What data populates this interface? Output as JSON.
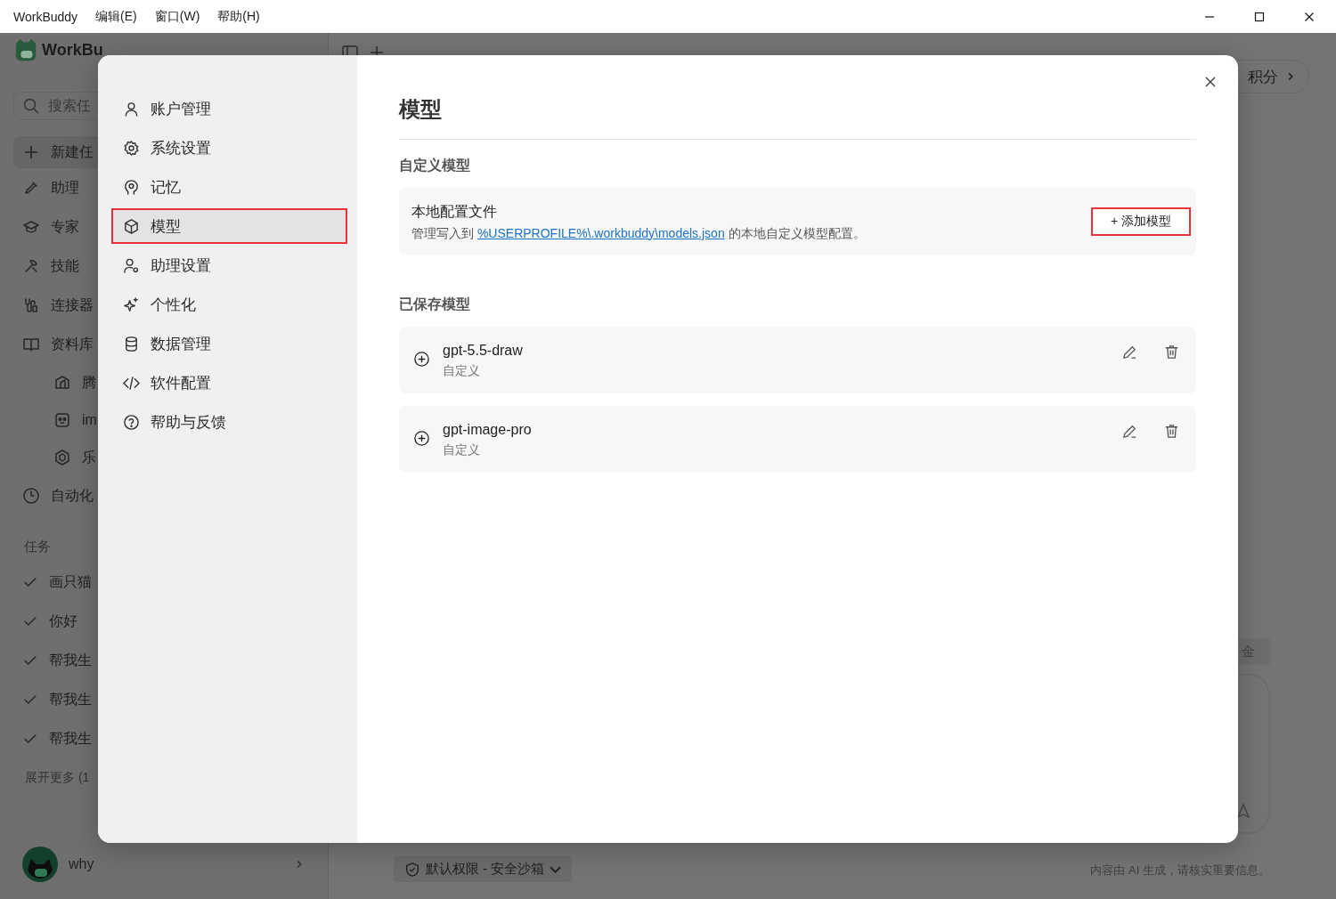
{
  "title_bar": {
    "app_name": "WorkBuddy",
    "menus": [
      "编辑(E)",
      "窗口(W)",
      "帮助(H)"
    ]
  },
  "sidebar": {
    "logo_text": "WorkBu",
    "search_placeholder": "搜索任",
    "new_task": "新建任",
    "items": [
      {
        "label": "助理",
        "kind": "item"
      },
      {
        "label": "专家",
        "kind": "item"
      },
      {
        "label": "技能",
        "kind": "item"
      },
      {
        "label": "连接器",
        "kind": "item"
      },
      {
        "label": "资料库",
        "kind": "item"
      },
      {
        "label": "腾",
        "kind": "subitem"
      },
      {
        "label": "im",
        "kind": "subitem"
      },
      {
        "label": "乐",
        "kind": "subitem"
      },
      {
        "label": "自动化",
        "kind": "item"
      }
    ],
    "tasks_heading": "任务",
    "tasks": [
      "画只猫",
      "你好",
      "帮我生",
      "帮我生",
      "帮我生"
    ],
    "more": "展开更多 (1",
    "user": "why"
  },
  "main": {
    "points_chip": "积分",
    "tag_chip": "金",
    "permission": "默认权限 - 安全沙箱",
    "disclaimer": "内容由 AI 生成，请核实重要信息。"
  },
  "settings": {
    "nav": [
      {
        "label": "账户管理",
        "selected": false,
        "highlighted": false
      },
      {
        "label": "系统设置",
        "selected": false,
        "highlighted": false
      },
      {
        "label": "记忆",
        "selected": false,
        "highlighted": false
      },
      {
        "label": "模型",
        "selected": true,
        "highlighted": true
      },
      {
        "label": "助理设置",
        "selected": false,
        "highlighted": false
      },
      {
        "label": "个性化",
        "selected": false,
        "highlighted": false
      },
      {
        "label": "数据管理",
        "selected": false,
        "highlighted": false
      },
      {
        "label": "软件配置",
        "selected": false,
        "highlighted": false
      },
      {
        "label": "帮助与反馈",
        "selected": false,
        "highlighted": false
      }
    ],
    "title": "模型",
    "custom_heading": "自定义模型",
    "config_card": {
      "title": "本地配置文件",
      "text_before": "管理写入到",
      "link": "%USERPROFILE%\\.workbuddy\\models.json",
      "text_after": "的本地自定义模型配置。",
      "add_button": {
        "label": "+ 添加模型",
        "highlighted": true
      }
    },
    "saved_heading": "已保存模型",
    "models": [
      {
        "name": "gpt-5.5-draw",
        "type": "自定义"
      },
      {
        "name": "gpt-image-pro",
        "type": "自定义"
      }
    ]
  }
}
